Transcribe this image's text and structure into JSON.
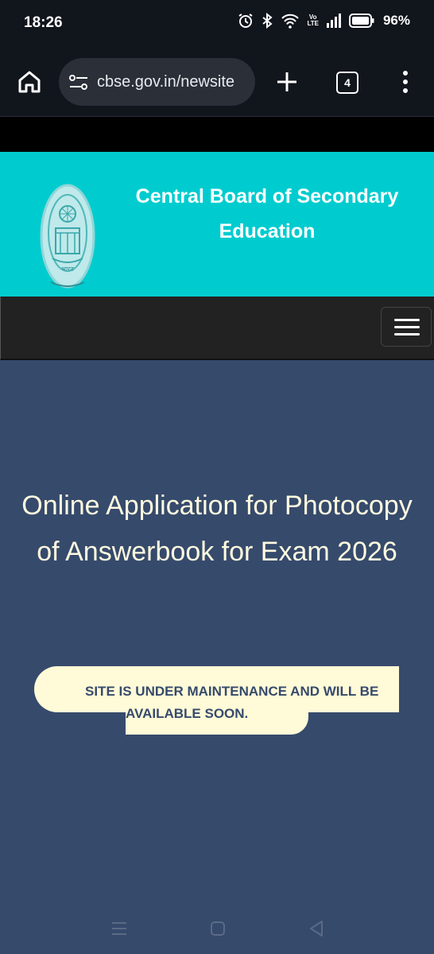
{
  "status_bar": {
    "time": "18:26",
    "network_top": "Vo",
    "network_bottom": "LTE",
    "battery": "96%"
  },
  "browser": {
    "url": "cbse.gov.in/newsite",
    "tab_count": "4"
  },
  "header": {
    "title_line1": "Central Board of Secondary",
    "title_line2": "Education",
    "logo_text": "भारत"
  },
  "main": {
    "heading_line1": "Online Application for Photocopy",
    "heading_line2": "of Answerbook for Exam 2026",
    "notice_line1": "SITE IS UNDER MAINTENANCE AND WILL BE",
    "notice_line2": "AVAILABLE SOON."
  },
  "colors": {
    "header_bg": "#00cccf",
    "page_bg": "#364a6c",
    "notice_bg": "#fffad7",
    "heading_text": "#fffbe0"
  }
}
